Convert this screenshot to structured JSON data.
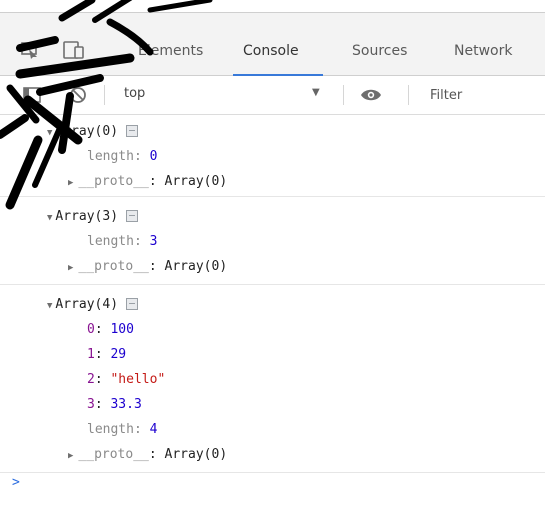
{
  "tabs": {
    "items": [
      "Elements",
      "Console",
      "Sources",
      "Network"
    ],
    "active": "Console"
  },
  "toolbar": {
    "context": "top",
    "filter_placeholder": "Filter"
  },
  "console": {
    "messages": [
      {
        "header": "Array(0)",
        "props": [
          {
            "key": "length",
            "value": "0"
          },
          {
            "key": "__proto__",
            "value": "Array(0)"
          }
        ]
      },
      {
        "header": "Array(3)",
        "props": [
          {
            "key": "length",
            "value": "3"
          },
          {
            "key": "__proto__",
            "value": "Array(0)"
          }
        ]
      },
      {
        "header": "Array(4)",
        "props": [
          {
            "key": "0",
            "value": "100"
          },
          {
            "key": "1",
            "value": "29"
          },
          {
            "key": "2",
            "value": "\"hello\""
          },
          {
            "key": "3",
            "value": "33.3"
          },
          {
            "key": "length",
            "value": "4"
          },
          {
            "key": "__proto__",
            "value": "Array(0)"
          }
        ]
      }
    ],
    "prompt": ">"
  },
  "colors": {
    "accent": "#3879d9",
    "key_purple": "#881391",
    "number_blue": "#1c00cf",
    "string_red": "#c41a16"
  }
}
